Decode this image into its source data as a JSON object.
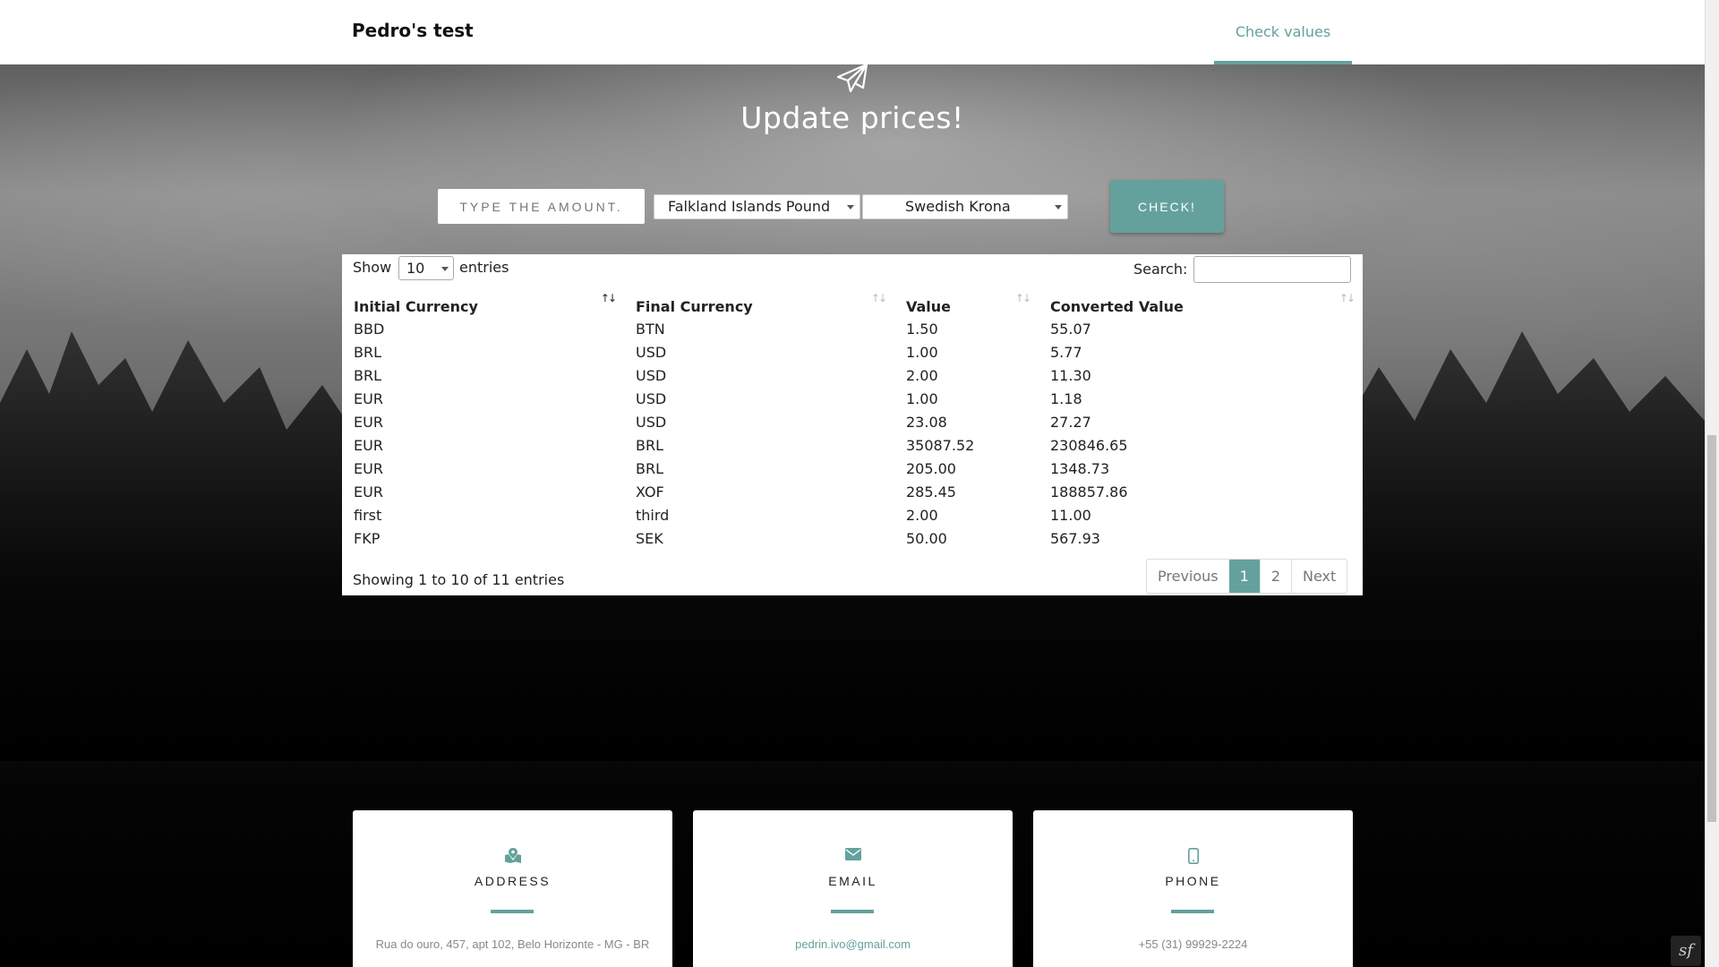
{
  "navbar": {
    "brand": "Pedro's test",
    "link": "Check values"
  },
  "hero": {
    "title": "Update prices!",
    "icon": "paper-plane-icon"
  },
  "form": {
    "amount_placeholder": "TYPE THE AMOUNT.",
    "from_currency": "Falkland Islands Pound",
    "to_currency": "Swedish Krona",
    "submit_label": "CHECK!"
  },
  "table": {
    "show_label": "Show",
    "page_length": "10",
    "entries_label": "entries",
    "search_label": "Search:",
    "columns": [
      "Initial Currency",
      "Final Currency",
      "Value",
      "Converted Value"
    ],
    "rows": [
      [
        "BBD",
        "BTN",
        "1.50",
        "55.07"
      ],
      [
        "BRL",
        "USD",
        "1.00",
        "5.77"
      ],
      [
        "BRL",
        "USD",
        "2.00",
        "11.30"
      ],
      [
        "EUR",
        "USD",
        "1.00",
        "1.18"
      ],
      [
        "EUR",
        "USD",
        "23.08",
        "27.27"
      ],
      [
        "EUR",
        "BRL",
        "35087.52",
        "230846.65"
      ],
      [
        "EUR",
        "BRL",
        "205.00",
        "1348.73"
      ],
      [
        "EUR",
        "XOF",
        "285.45",
        "188857.86"
      ],
      [
        "first",
        "third",
        "2.00",
        "11.00"
      ],
      [
        "FKP",
        "SEK",
        "50.00",
        "567.93"
      ]
    ],
    "info": "Showing 1 to 10 of 11 entries",
    "pagination": {
      "previous": "Previous",
      "pages": [
        "1",
        "2"
      ],
      "current": "1",
      "next": "Next"
    }
  },
  "contact": {
    "address": {
      "title": "ADDRESS",
      "value": "Rua do ouro, 457, apt 102, Belo Horizonte - MG - BR",
      "icon": "map-marked-icon"
    },
    "email": {
      "title": "EMAIL",
      "value": "pedrin.ivo@gmail.com",
      "icon": "envelope-icon"
    },
    "phone": {
      "title": "PHONE",
      "value": "+55 (31) 99929-2224",
      "icon": "mobile-icon"
    }
  },
  "colors": {
    "accent": "#64a19d"
  }
}
